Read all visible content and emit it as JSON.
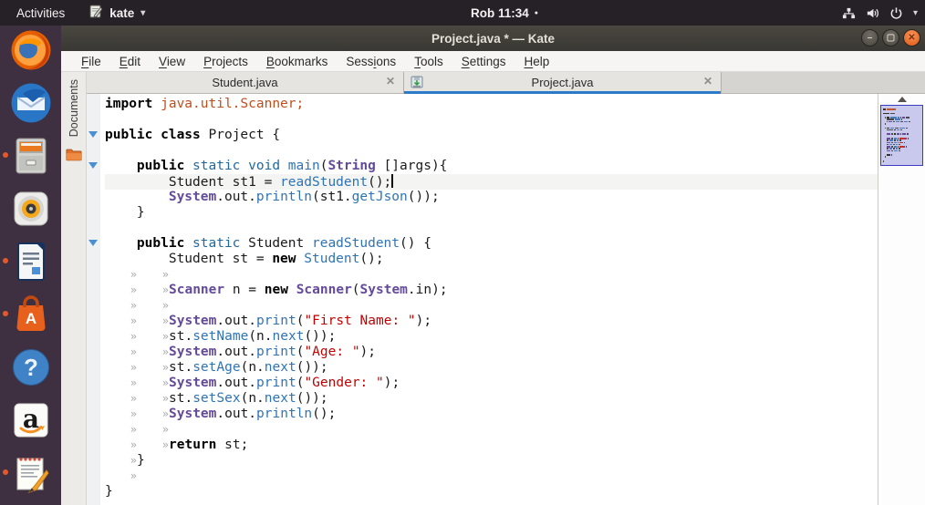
{
  "top_bar": {
    "activities_label": "Activities",
    "app_menu_label": "kate",
    "clock_label": "Rob 11:34",
    "notification_dot": "●",
    "chevron": "▾",
    "tray_icons": [
      "network",
      "volume",
      "power"
    ]
  },
  "dock": {
    "items": [
      {
        "name": "firefox",
        "running": false
      },
      {
        "name": "thunderbird",
        "running": false
      },
      {
        "name": "files",
        "running": true
      },
      {
        "name": "rhythmbox",
        "running": false
      },
      {
        "name": "libreoffice-writer",
        "running": true
      },
      {
        "name": "ubuntu-software",
        "running": true
      },
      {
        "name": "help",
        "running": false
      },
      {
        "name": "amazon",
        "running": false
      },
      {
        "name": "text-editor",
        "running": true
      }
    ]
  },
  "window": {
    "title": "Project.java * — Kate",
    "controls": [
      {
        "name": "minimize",
        "glyph": "–"
      },
      {
        "name": "maximize",
        "glyph": "▢"
      },
      {
        "name": "close",
        "glyph": "✕"
      }
    ]
  },
  "menu_bar": {
    "items": [
      {
        "label": "File",
        "mnemonic_index": 0
      },
      {
        "label": "Edit",
        "mnemonic_index": 0
      },
      {
        "label": "View",
        "mnemonic_index": 0
      },
      {
        "label": "Projects",
        "mnemonic_index": 0
      },
      {
        "label": "Bookmarks",
        "mnemonic_index": 0
      },
      {
        "label": "Sessions",
        "mnemonic_index": 4
      },
      {
        "label": "Tools",
        "mnemonic_index": 0
      },
      {
        "label": "Settings",
        "mnemonic_index": 0
      },
      {
        "label": "Help",
        "mnemonic_index": 0
      }
    ]
  },
  "tab_bar": {
    "close_glyph": "✕",
    "tabs": [
      {
        "label": "Student.java",
        "active": false,
        "modified": false
      },
      {
        "label": "Project.java",
        "active": true,
        "modified": true
      }
    ]
  },
  "toolviews": {
    "documents_label": "Documents"
  },
  "editor": {
    "language": "Java",
    "lines": [
      {
        "segments": [
          [
            "kw",
            "import "
          ],
          [
            "imp",
            "java.util.Scanner;"
          ]
        ]
      },
      {
        "segments": []
      },
      {
        "fold": true,
        "segments": [
          [
            "kw",
            "public class "
          ],
          [
            "txt",
            "Project {"
          ]
        ]
      },
      {
        "segments": []
      },
      {
        "fold": true,
        "segments": [
          [
            "txt",
            "    "
          ],
          [
            "kw",
            "public "
          ],
          [
            "dt",
            "static void "
          ],
          [
            "fn",
            "main"
          ],
          [
            "txt",
            "("
          ],
          [
            "cls",
            "String"
          ],
          [
            "txt",
            " []args){"
          ]
        ]
      },
      {
        "current": true,
        "caret": true,
        "segments": [
          [
            "txt",
            "        Student st1 = "
          ],
          [
            "fn",
            "readStudent"
          ],
          [
            "txt",
            "();"
          ]
        ]
      },
      {
        "segments": [
          [
            "txt",
            "        "
          ],
          [
            "cls",
            "System"
          ],
          [
            "txt",
            ".out."
          ],
          [
            "fn",
            "println"
          ],
          [
            "txt",
            "(st1."
          ],
          [
            "fn",
            "getJson"
          ],
          [
            "txt",
            "());"
          ]
        ]
      },
      {
        "segments": [
          [
            "txt",
            "    }"
          ]
        ]
      },
      {
        "segments": []
      },
      {
        "fold": true,
        "segments": [
          [
            "txt",
            "    "
          ],
          [
            "kw",
            "public "
          ],
          [
            "dt",
            "static "
          ],
          [
            "txt",
            "Student "
          ],
          [
            "fn",
            "readStudent"
          ],
          [
            "txt",
            "() {"
          ]
        ]
      },
      {
        "segments": [
          [
            "txt",
            "        Student st = "
          ],
          [
            "kw",
            "new "
          ],
          [
            "fn",
            "Student"
          ],
          [
            "txt",
            "();"
          ]
        ]
      },
      {
        "tabs": 2,
        "segments": []
      },
      {
        "tabs": 2,
        "segments": [
          [
            "cls",
            "Scanner"
          ],
          [
            "txt",
            " n = "
          ],
          [
            "kw",
            "new "
          ],
          [
            "cls",
            "Scanner"
          ],
          [
            "txt",
            "("
          ],
          [
            "cls",
            "System"
          ],
          [
            "txt",
            ".in);"
          ]
        ]
      },
      {
        "tabs": 2,
        "segments": []
      },
      {
        "tabs": 2,
        "segments": [
          [
            "cls",
            "System"
          ],
          [
            "txt",
            ".out."
          ],
          [
            "fn",
            "print"
          ],
          [
            "txt",
            "("
          ],
          [
            "str",
            "\"First Name: \""
          ],
          [
            "txt",
            ");"
          ]
        ]
      },
      {
        "tabs": 2,
        "segments": [
          [
            "txt",
            "st."
          ],
          [
            "fn",
            "setName"
          ],
          [
            "txt",
            "(n."
          ],
          [
            "fn",
            "next"
          ],
          [
            "txt",
            "());"
          ]
        ]
      },
      {
        "tabs": 2,
        "segments": [
          [
            "cls",
            "System"
          ],
          [
            "txt",
            ".out."
          ],
          [
            "fn",
            "print"
          ],
          [
            "txt",
            "("
          ],
          [
            "str",
            "\"Age: \""
          ],
          [
            "txt",
            ");"
          ]
        ]
      },
      {
        "tabs": 2,
        "segments": [
          [
            "txt",
            "st."
          ],
          [
            "fn",
            "setAge"
          ],
          [
            "txt",
            "(n."
          ],
          [
            "fn",
            "next"
          ],
          [
            "txt",
            "());"
          ]
        ]
      },
      {
        "tabs": 2,
        "segments": [
          [
            "cls",
            "System"
          ],
          [
            "txt",
            ".out."
          ],
          [
            "fn",
            "print"
          ],
          [
            "txt",
            "("
          ],
          [
            "str",
            "\"Gender: \""
          ],
          [
            "txt",
            ");"
          ]
        ]
      },
      {
        "tabs": 2,
        "segments": [
          [
            "txt",
            "st."
          ],
          [
            "fn",
            "setSex"
          ],
          [
            "txt",
            "(n."
          ],
          [
            "fn",
            "next"
          ],
          [
            "txt",
            "());"
          ]
        ]
      },
      {
        "tabs": 2,
        "segments": [
          [
            "cls",
            "System"
          ],
          [
            "txt",
            ".out."
          ],
          [
            "fn",
            "println"
          ],
          [
            "txt",
            "();"
          ]
        ]
      },
      {
        "tabs": 2,
        "segments": []
      },
      {
        "tabs": 2,
        "segments": [
          [
            "kw",
            "return "
          ],
          [
            "txt",
            "st;"
          ]
        ]
      },
      {
        "tabs": 1,
        "segments": [
          [
            "txt",
            "}"
          ]
        ]
      },
      {
        "tabs": 1,
        "segments": []
      },
      {
        "segments": [
          [
            "txt",
            "}"
          ]
        ]
      }
    ]
  },
  "colors": {
    "accent_blue": "#2d7bc8",
    "keyword": "#000000",
    "data_type": "#21699c",
    "function": "#2e74b5",
    "class_name": "#644a9b",
    "string": "#bf0303",
    "import": "#bf4d1c",
    "current_line_bg": "#f4f4f2",
    "fold_arrow": "#4a8fd2",
    "dock_running_dot": "#e4582c",
    "top_bar_bg": "#262126",
    "dock_bg": "#3e3040"
  }
}
